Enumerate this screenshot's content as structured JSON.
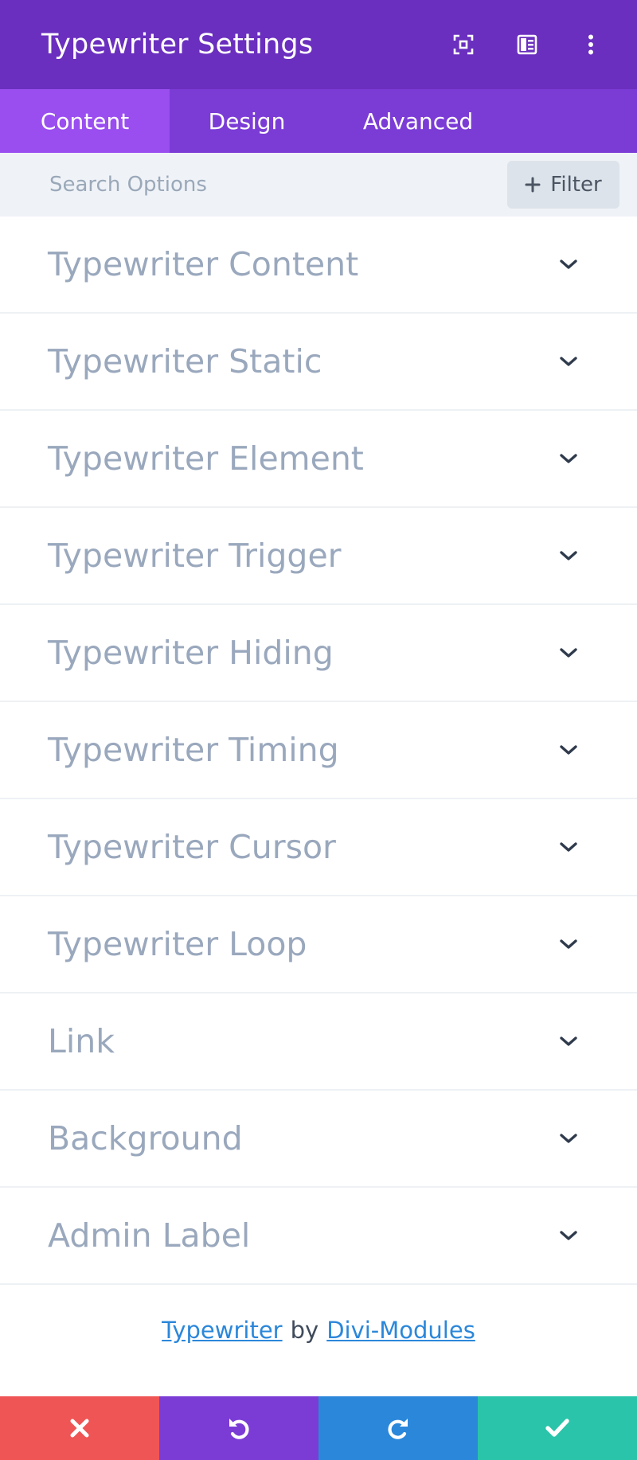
{
  "header": {
    "title": "Typewriter Settings",
    "icons": [
      "expand-icon",
      "sidebar-icon",
      "more-icon"
    ],
    "bg_color": "#6a2fbe"
  },
  "tabs": [
    {
      "label": "Content",
      "active": true
    },
    {
      "label": "Design",
      "active": false
    },
    {
      "label": "Advanced",
      "active": false
    }
  ],
  "search": {
    "placeholder": "Search Options",
    "value": "",
    "filter_label": "Filter"
  },
  "toggles": [
    {
      "label": "Typewriter Content"
    },
    {
      "label": "Typewriter Static"
    },
    {
      "label": "Typewriter Element"
    },
    {
      "label": "Typewriter Trigger"
    },
    {
      "label": "Typewriter Hiding"
    },
    {
      "label": "Typewriter Timing"
    },
    {
      "label": "Typewriter Cursor"
    },
    {
      "label": "Typewriter Loop"
    },
    {
      "label": "Link"
    },
    {
      "label": "Background"
    },
    {
      "label": "Admin Label"
    }
  ],
  "credits": {
    "module_link": "Typewriter",
    "by": "by",
    "author_link": "Divi-Modules"
  },
  "footer": {
    "buttons": [
      {
        "name": "discard",
        "icon": "close-icon",
        "color": "#ef5555"
      },
      {
        "name": "undo",
        "icon": "undo-icon",
        "color": "#7b3cd6"
      },
      {
        "name": "redo",
        "icon": "redo-icon",
        "color": "#2b87da"
      },
      {
        "name": "save",
        "icon": "check-icon",
        "color": "#29c4a9"
      }
    ]
  }
}
